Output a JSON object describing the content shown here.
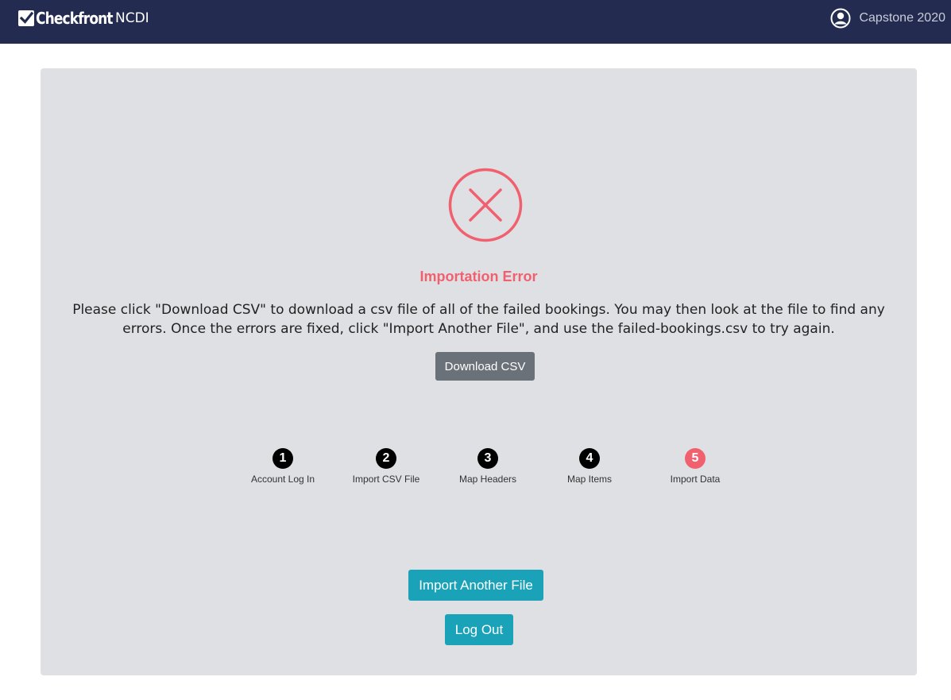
{
  "header": {
    "brand_name": "Checkfront",
    "brand_sub": "NCDI",
    "user_name": "Capstone 2020"
  },
  "error": {
    "title": "Importation Error",
    "message": "Please click \"Download CSV\" to download a csv file of all of the failed bookings. You may then look at the file to find any errors. Once the errors are fixed, click \"Import Another File\", and use the failed-bookings.csv to try again.",
    "download_label": "Download CSV"
  },
  "steps": [
    {
      "num": "1",
      "label": "Account Log In",
      "active": false
    },
    {
      "num": "2",
      "label": "Import CSV File",
      "active": false
    },
    {
      "num": "3",
      "label": "Map Headers",
      "active": false
    },
    {
      "num": "4",
      "label": "Map Items",
      "active": false
    },
    {
      "num": "5",
      "label": "Import Data",
      "active": true
    }
  ],
  "actions": {
    "import_another_label": "Import Another File",
    "logout_label": "Log Out"
  },
  "colors": {
    "navbar": "#232c50",
    "error": "#f0606f",
    "teal": "#1aa3b8",
    "panel": "#dfe0e4"
  },
  "icons": {
    "brand": "checkbox-icon",
    "user": "user-circle-icon",
    "error": "error-x-circle-icon"
  }
}
